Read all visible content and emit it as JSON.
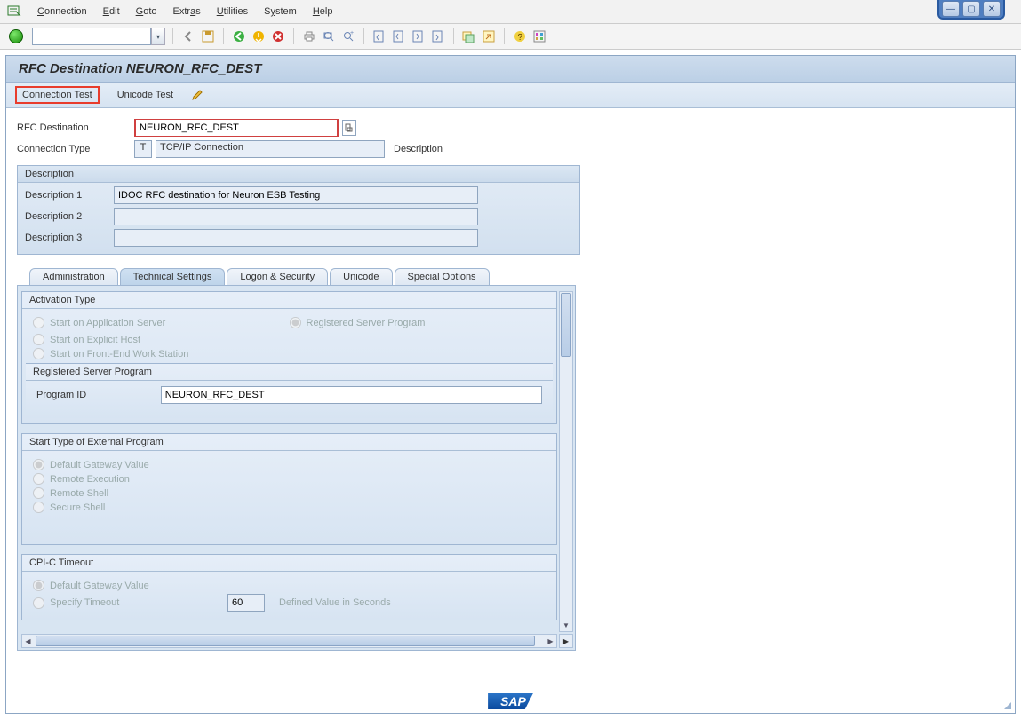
{
  "menu": {
    "items": [
      "Connection",
      "Edit",
      "Goto",
      "Extras",
      "Utilities",
      "System",
      "Help"
    ]
  },
  "title": "RFC Destination NEURON_RFC_DEST",
  "appTabs": {
    "connectionTest": "Connection Test",
    "unicodeTest": "Unicode Test"
  },
  "fields": {
    "rfcDestLabel": "RFC Destination",
    "rfcDestValue": "NEURON_RFC_DEST",
    "connTypeLabel": "Connection Type",
    "connTypeCode": "T",
    "connTypeText": "TCP/IP Connection",
    "descriptionLabel": "Description"
  },
  "descGroup": {
    "title": "Description",
    "d1label": "Description 1",
    "d1value": "IDOC RFC destination for Neuron ESB Testing",
    "d2label": "Description 2",
    "d2value": "",
    "d3label": "Description 3",
    "d3value": ""
  },
  "tabs": {
    "admin": "Administration",
    "tech": "Technical Settings",
    "logon": "Logon & Security",
    "unicode": "Unicode",
    "special": "Special Options"
  },
  "activation": {
    "title": "Activation Type",
    "startAppServer": "Start on Application Server",
    "registered": "Registered Server Program",
    "startExplicit": "Start on Explicit Host",
    "startFrontEnd": "Start on Front-End Work Station"
  },
  "regProg": {
    "title": "Registered Server Program",
    "progIdLabel": "Program ID",
    "progIdValue": "NEURON_RFC_DEST"
  },
  "startType": {
    "title": "Start Type of External Program",
    "default": "Default Gateway Value",
    "remoteExec": "Remote Execution",
    "remoteShell": "Remote Shell",
    "secureShell": "Secure Shell"
  },
  "cpic": {
    "title": "CPI-C Timeout",
    "default": "Default Gateway Value",
    "specify": "Specify Timeout",
    "timeoutValue": "60",
    "definedLabel": "Defined Value in Seconds"
  },
  "sapLogo": "SAP"
}
